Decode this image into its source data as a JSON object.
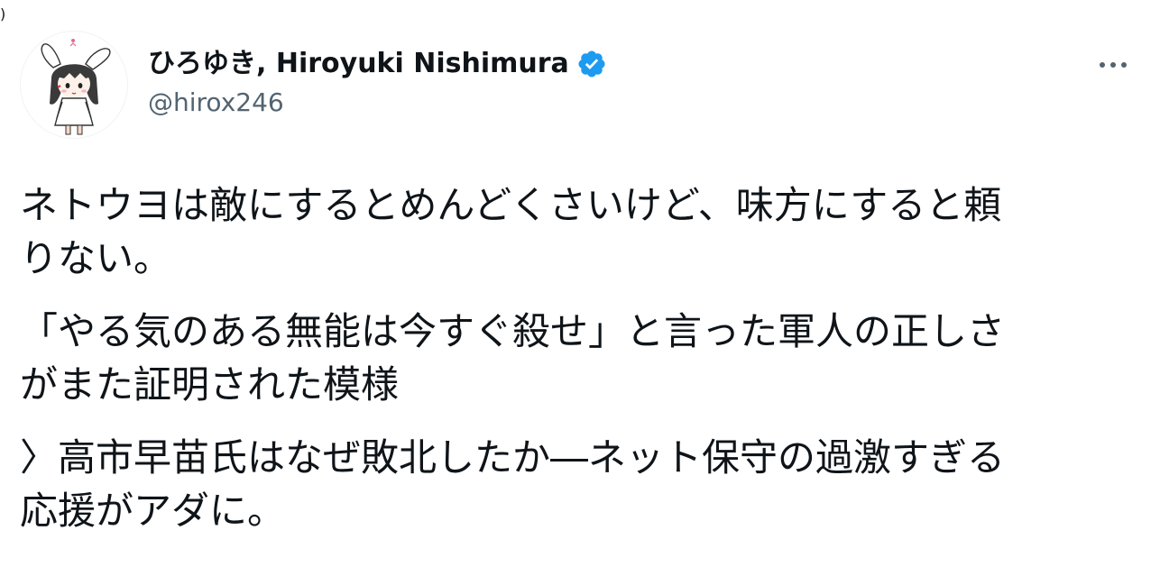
{
  "corner_mark": ")",
  "author": {
    "display_name": "ひろゆき, Hiroyuki Nishimura",
    "handle": "@hirox246",
    "verified": true,
    "avatar_icon": "avatar-rabbit-girl-icon"
  },
  "more_icon": "more-horizontal-icon",
  "tweet": {
    "paragraphs": [
      {
        "lines": [
          "ネトウヨは敵にするとめんどくさいけど、味方にすると頼",
          "りない。"
        ]
      },
      {
        "lines": [
          "「やる気のある無能は今すぐ殺せ」と言った軍人の正しさ",
          "がまた証明された模様"
        ]
      },
      {
        "lines": [
          "〉高市早苗氏はなぜ敗北したか―ネット保守の過激すぎる",
          "応援がアダに。"
        ]
      }
    ]
  },
  "colors": {
    "text": "#0f1419",
    "secondary": "#536471",
    "verified_blue": "#1d9bf0",
    "background": "#ffffff"
  }
}
